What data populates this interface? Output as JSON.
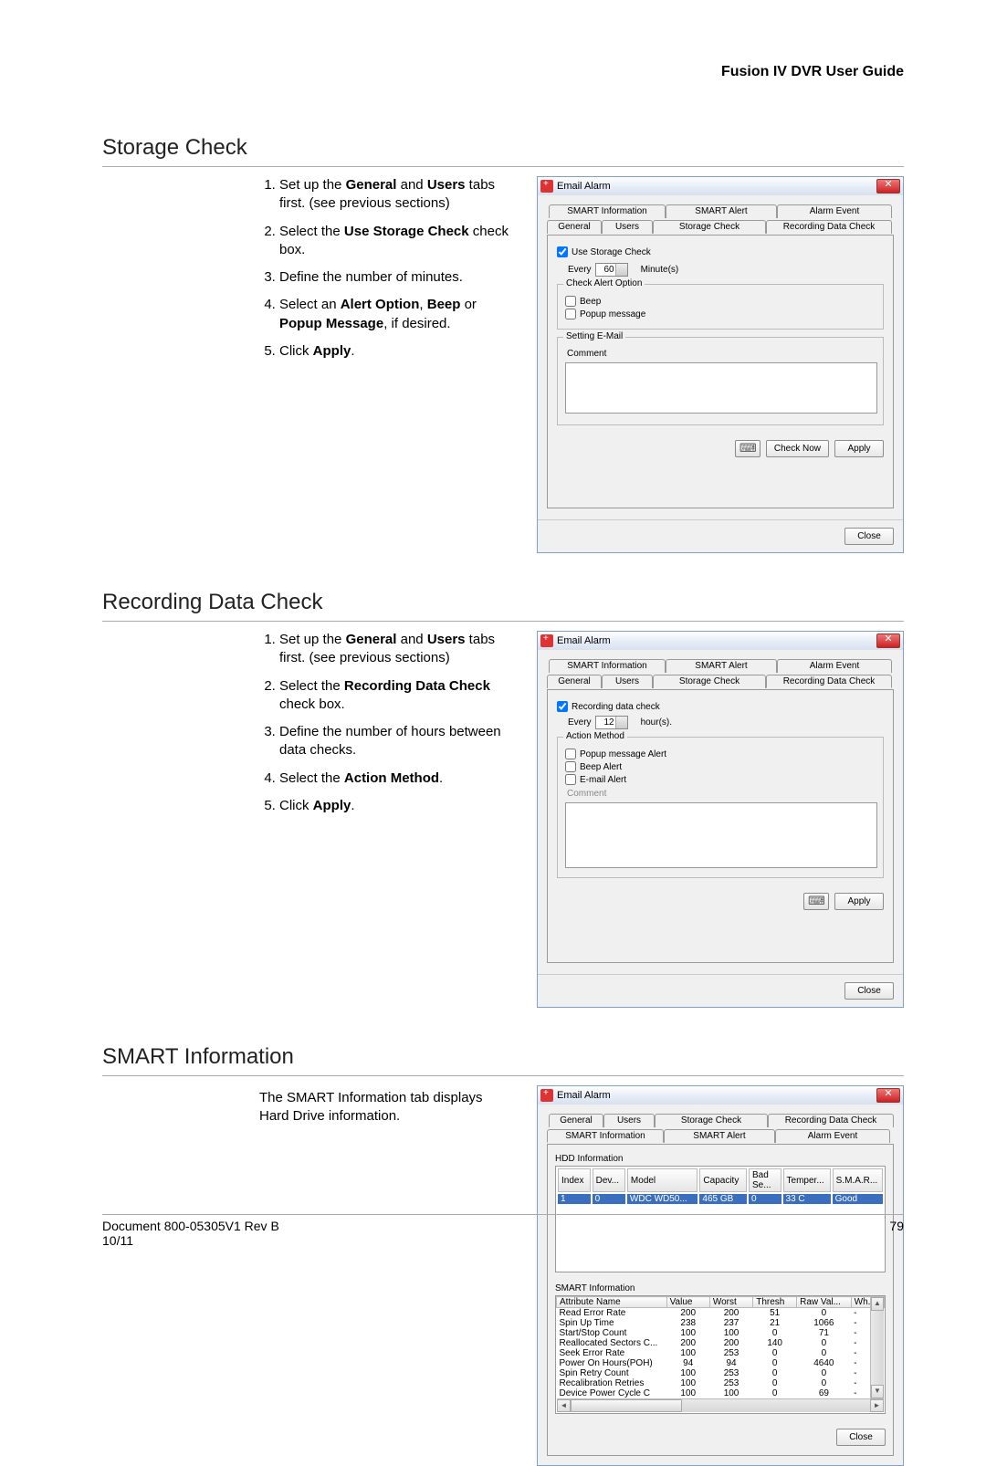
{
  "header": {
    "title": "Fusion IV DVR User Guide"
  },
  "footer": {
    "doc": "Document 800-05305V1 Rev B",
    "date": "10/11",
    "page": "79"
  },
  "sections": {
    "storage": {
      "title": "Storage Check",
      "steps": [
        "Set up the <b>General</b> and <b>Users</b> tabs first. (see previous sections)",
        "Select the <b>Use Storage Check</b> check box.",
        "Define the number of minutes.",
        "Select an <b>Alert Option</b>, <b>Beep</b> or <b>Popup Message</b>, if desired.",
        "Click <b>Apply</b>."
      ],
      "dlg": {
        "title": "Email Alarm",
        "tabs": {
          "row1": [
            "SMART Information",
            "SMART Alert",
            "Alarm Event"
          ],
          "row2": [
            "General",
            "Users",
            "Storage Check",
            "Recording Data Check"
          ],
          "active": "Storage Check"
        },
        "use_label": "Use Storage Check",
        "use_checked": true,
        "every": "Every",
        "every_val": "60",
        "every_unit": "Minute(s)",
        "cao_title": "Check Alert Option",
        "beep": "Beep",
        "popup": "Popup message",
        "sem_title": "Setting E-Mail",
        "comment": "Comment",
        "check_now": "Check Now",
        "apply": "Apply",
        "close": "Close"
      }
    },
    "recording": {
      "title": "Recording Data Check",
      "steps": [
        "Set up the <b>General</b> and <b>Users</b> tabs first. (see previous sections)",
        "Select the <b>Recording Data Check</b> check box.",
        "Define the number of hours between data checks.",
        "Select the <b>Action Method</b>.",
        "Click <b>Apply</b>."
      ],
      "dlg": {
        "title": "Email Alarm",
        "tabs": {
          "row1": [
            "SMART Information",
            "SMART Alert",
            "Alarm Event"
          ],
          "row2": [
            "General",
            "Users",
            "Storage Check",
            "Recording Data Check"
          ],
          "active": "Recording Data Check"
        },
        "rdc_label": "Recording data check",
        "rdc_checked": true,
        "every": "Every",
        "every_val": "12",
        "every_unit": "hour(s).",
        "am_title": "Action Method",
        "pma": "Popup message Alert",
        "ba": "Beep Alert",
        "ea": "E-mail Alert",
        "comment": "Comment",
        "apply": "Apply",
        "close": "Close"
      }
    },
    "smart": {
      "title": "SMART Information",
      "desc": "The SMART Information tab displays Hard Drive information.",
      "dlg": {
        "title": "Email Alarm",
        "tabs": {
          "row1": [
            "General",
            "Users",
            "Storage Check",
            "Recording Data Check"
          ],
          "row2": [
            "SMART Information",
            "SMART Alert",
            "Alarm Event"
          ],
          "active": "SMART Information"
        },
        "hdd_title": "HDD Information",
        "hdd_cols": [
          "Index",
          "Dev...",
          "Model",
          "Capacity",
          "Bad Se...",
          "Temper...",
          "S.M.A.R..."
        ],
        "hdd_row": [
          "1",
          "0",
          "WDC WD50...",
          "465 GB",
          "0",
          "33 C",
          "Good"
        ],
        "si_title": "SMART Information",
        "si_cols": [
          "Attribute Name",
          "Value",
          "Worst",
          "Thresh",
          "Raw Val...",
          "Wh..."
        ],
        "si_rows": [
          [
            "Read Error Rate",
            "200",
            "200",
            "51",
            "0",
            "-"
          ],
          [
            "Spin Up Time",
            "238",
            "237",
            "21",
            "1066",
            "-"
          ],
          [
            "Start/Stop Count",
            "100",
            "100",
            "0",
            "71",
            "-"
          ],
          [
            "Reallocated Sectors C...",
            "200",
            "200",
            "140",
            "0",
            "-"
          ],
          [
            "Seek Error Rate",
            "100",
            "253",
            "0",
            "0",
            "-"
          ],
          [
            "Power On Hours(POH)",
            "94",
            "94",
            "0",
            "4640",
            "-"
          ],
          [
            "Spin Retry Count",
            "100",
            "253",
            "0",
            "0",
            "-"
          ],
          [
            "Recalibration Retries",
            "100",
            "253",
            "0",
            "0",
            "-"
          ],
          [
            "Device Power Cycle C",
            "100",
            "100",
            "0",
            "69",
            "-"
          ]
        ],
        "close": "Close"
      }
    }
  }
}
